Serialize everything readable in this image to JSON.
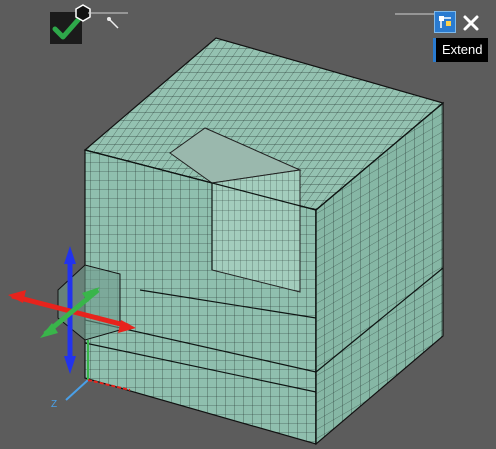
{
  "tooltip": {
    "label": "Extend"
  },
  "triad": {
    "z_label": "Z"
  },
  "colors": {
    "background": "#5c5c5c",
    "mesh_fill": "#8fbfae",
    "mesh_line": "#1f2e2a",
    "accent": "#2a7bd0",
    "x_axis": "#e8231c",
    "y_axis": "#39b54a",
    "z_axis": "#2233ee",
    "check": "#2ea84a"
  },
  "icons": {
    "apply": "check-icon",
    "pin": "pin-icon",
    "tool": "extend-tool-icon",
    "close": "close-icon"
  }
}
